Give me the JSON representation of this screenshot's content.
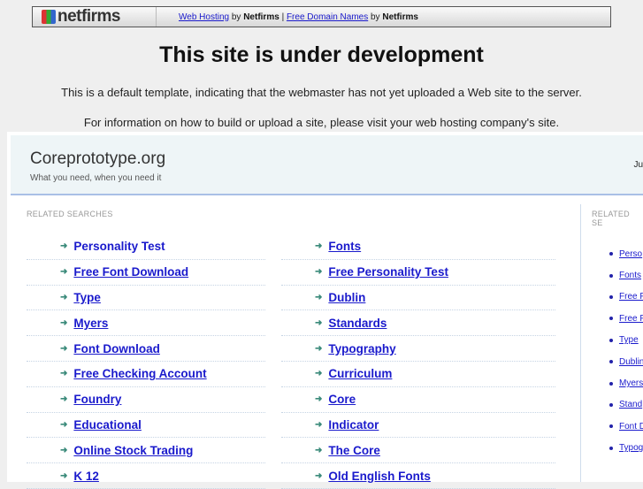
{
  "topbar": {
    "logo": "netfirms",
    "link1": "Web Hosting",
    "by1": "by",
    "brand1": "Netfirms",
    "sep": "|",
    "link2": "Free Domain Names",
    "by2": "by",
    "brand2": "Netfirms"
  },
  "title": "This site is under development",
  "para1": "This is a default template, indicating that the webmaster has not yet uploaded a Web site to the server.",
  "para2": "For information on how to build or upload a site, please visit your web hosting company's site.",
  "site": {
    "name": "Coreprototype.org",
    "tagline": "What you need, when you need it",
    "right_text": "Ju"
  },
  "main": {
    "label": "RELATED SEARCHES",
    "col1": [
      "Personality Test",
      "Free Font Download",
      "Type",
      "Myers",
      "Font Download",
      "Free Checking Account",
      "Foundry",
      "Educational",
      "Online Stock Trading",
      "K 12"
    ],
    "col2": [
      "Fonts",
      "Free Personality Test",
      "Dublin",
      "Standards",
      "Typography",
      "Curriculum",
      "Core",
      "Indicator",
      "The Core",
      "Old English Fonts"
    ]
  },
  "side": {
    "label": "RELATED SE",
    "items": [
      "Perso",
      "Fonts",
      "Free F",
      "Free F",
      "Type",
      "Dublin",
      "Myers",
      "Stand",
      "Font D",
      "Typog"
    ]
  }
}
